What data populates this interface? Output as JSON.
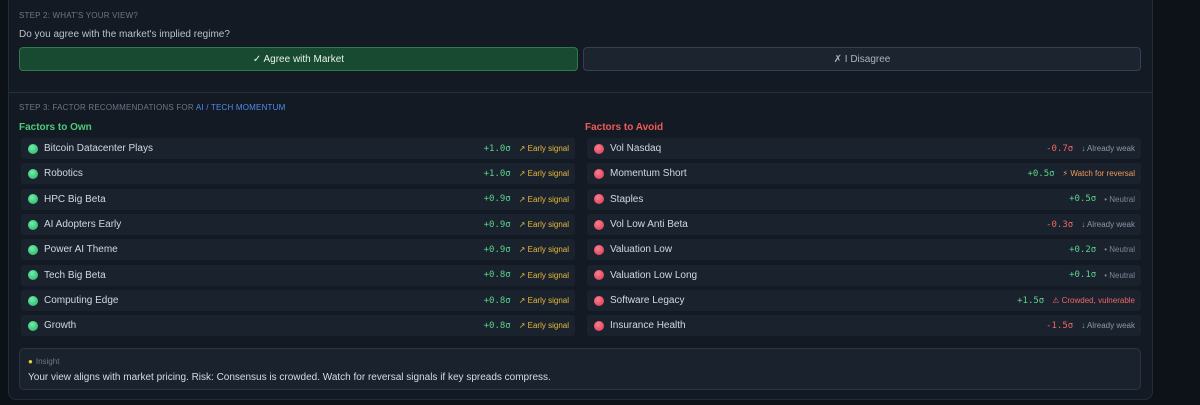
{
  "step2": {
    "label": "STEP 2: WHAT'S YOUR VIEW?",
    "question": "Do you agree with the market's implied regime?",
    "agree_label": "✓ Agree with Market",
    "disagree_label": "✗ I Disagree"
  },
  "step3": {
    "label_prefix": "STEP 3: FACTOR RECOMMENDATIONS FOR ",
    "label_regime": "AI / TECH MOMENTUM"
  },
  "own": {
    "title": "Factors to Own",
    "items": [
      {
        "name": "Bitcoin Datacenter Plays",
        "score": "+1.0σ",
        "signal": "↗ Early signal"
      },
      {
        "name": "Robotics",
        "score": "+1.0σ",
        "signal": "↗ Early signal"
      },
      {
        "name": "HPC Big Beta",
        "score": "+0.9σ",
        "signal": "↗ Early signal"
      },
      {
        "name": "AI Adopters Early",
        "score": "+0.9σ",
        "signal": "↗ Early signal"
      },
      {
        "name": "Power AI Theme",
        "score": "+0.9σ",
        "signal": "↗ Early signal"
      },
      {
        "name": "Tech Big Beta",
        "score": "+0.8σ",
        "signal": "↗ Early signal"
      },
      {
        "name": "Computing Edge",
        "score": "+0.8σ",
        "signal": "↗ Early signal"
      },
      {
        "name": "Growth",
        "score": "+0.8σ",
        "signal": "↗ Early signal"
      }
    ]
  },
  "avoid": {
    "title": "Factors to Avoid",
    "items": [
      {
        "name": "Vol Nasdaq",
        "score": "-0.7σ",
        "signal": "↓ Already weak",
        "kind": "weak"
      },
      {
        "name": "Momentum Short",
        "score": "+0.5σ",
        "signal": "⚡ Watch for reversal",
        "kind": "reversal"
      },
      {
        "name": "Staples",
        "score": "+0.5σ",
        "signal": "• Neutral",
        "kind": "neutral"
      },
      {
        "name": "Vol Low Anti Beta",
        "score": "-0.3σ",
        "signal": "↓ Already weak",
        "kind": "weak"
      },
      {
        "name": "Valuation Low",
        "score": "+0.2σ",
        "signal": "• Neutral",
        "kind": "neutral"
      },
      {
        "name": "Valuation Low Long",
        "score": "+0.1σ",
        "signal": "• Neutral",
        "kind": "neutral"
      },
      {
        "name": "Software Legacy",
        "score": "+1.5σ",
        "signal": "⚠ Crowded, vulnerable",
        "kind": "crowded"
      },
      {
        "name": "Insurance Health",
        "score": "-1.5σ",
        "signal": "↓ Already weak",
        "kind": "weak"
      }
    ]
  },
  "insight": {
    "icon": "lightbulb-icon",
    "label": "Insight",
    "text": "Your view aligns with market pricing. Risk: Consensus is crowded. Watch for reversal signals if key spreads compress."
  },
  "colors": {
    "accent_blue": "#4f8cf0",
    "own_green": "#4ccc7a",
    "avoid_red": "#ef5a5a",
    "early_yellow": "#e8b93a"
  }
}
